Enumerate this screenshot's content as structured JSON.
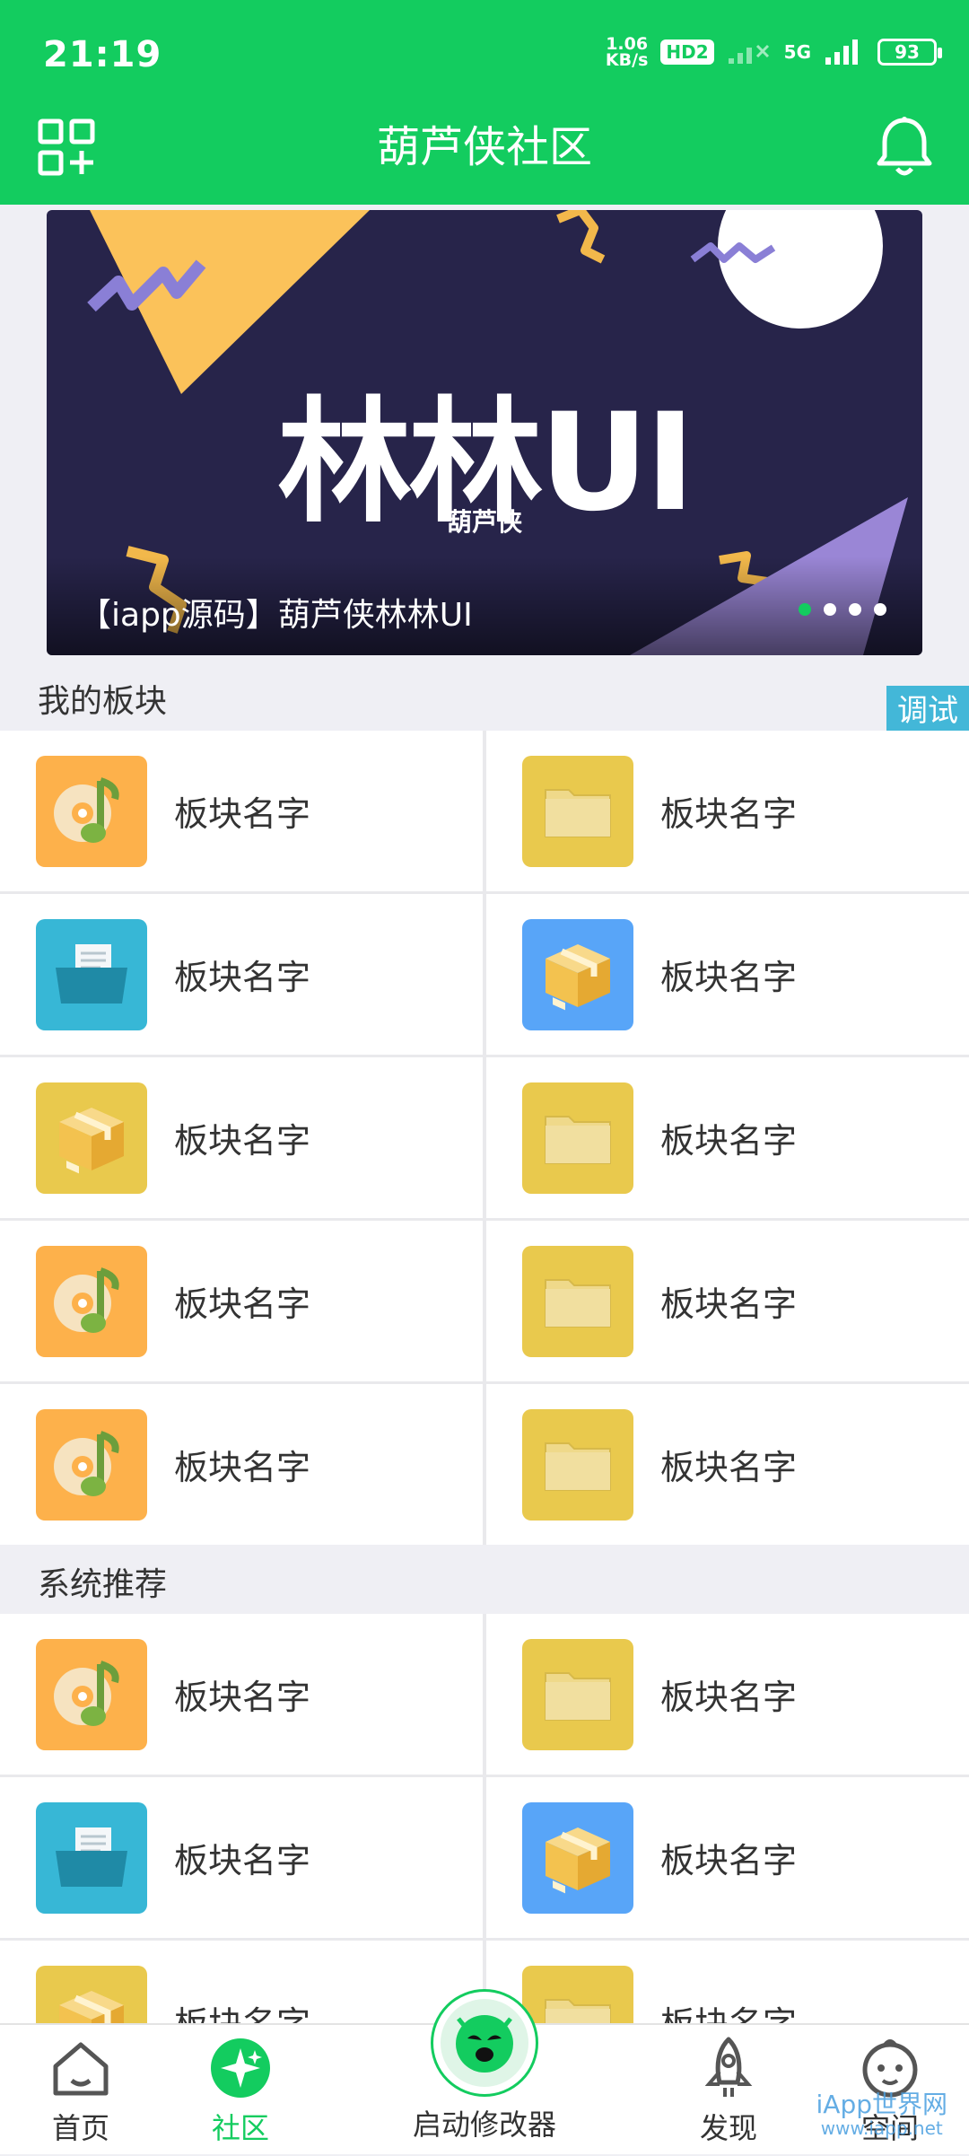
{
  "status_bar": {
    "time": "21:19",
    "net_speed_value": "1.06",
    "net_speed_unit": "KB/s",
    "hd_badge": "HD2",
    "network": "5G",
    "battery": "93"
  },
  "header": {
    "title": "葫芦侠社区"
  },
  "banner": {
    "headline": "林林UI",
    "subline": "葫芦侠",
    "caption": "【iapp源码】葫芦侠林林UI",
    "page_count": 4,
    "active_index": 0
  },
  "debug_label": "调试",
  "my_boards": {
    "title": "我的板块",
    "items": [
      {
        "label": "板块名字",
        "icon": "music-disc-icon",
        "color": "#fdb14b"
      },
      {
        "label": "板块名字",
        "icon": "folder-icon",
        "color": "#e9c94d"
      },
      {
        "label": "板块名字",
        "icon": "file-folder-icon",
        "color": "#37b7d6"
      },
      {
        "label": "板块名字",
        "icon": "package-box-icon",
        "color": "#58a5f8"
      },
      {
        "label": "板块名字",
        "icon": "package-box-icon",
        "color": "#e9c94d"
      },
      {
        "label": "板块名字",
        "icon": "folder-icon",
        "color": "#e9c94d"
      },
      {
        "label": "板块名字",
        "icon": "music-disc-icon",
        "color": "#fdb14b"
      },
      {
        "label": "板块名字",
        "icon": "folder-icon",
        "color": "#e9c94d"
      },
      {
        "label": "板块名字",
        "icon": "music-disc-icon",
        "color": "#fdb14b"
      },
      {
        "label": "板块名字",
        "icon": "folder-icon",
        "color": "#e9c94d"
      }
    ]
  },
  "recommended": {
    "title": "系统推荐",
    "items": [
      {
        "label": "板块名字",
        "icon": "music-disc-icon",
        "color": "#fdb14b"
      },
      {
        "label": "板块名字",
        "icon": "folder-icon",
        "color": "#e9c94d"
      },
      {
        "label": "板块名字",
        "icon": "file-folder-icon",
        "color": "#37b7d6"
      },
      {
        "label": "板块名字",
        "icon": "package-box-icon",
        "color": "#58a5f8"
      },
      {
        "label": "板块名字",
        "icon": "package-box-icon",
        "color": "#e9c94d"
      },
      {
        "label": "板块名字",
        "icon": "folder-icon",
        "color": "#e9c94d"
      }
    ]
  },
  "bottom_nav": {
    "home": "首页",
    "community": "社区",
    "center": "启动修改器",
    "discover": "发现",
    "space": "空间"
  },
  "watermark": {
    "line1": "iApp世界网",
    "line2": "www.iapp.net"
  },
  "colors": {
    "primary": "#13cc5f",
    "banner_bg": "#27244a"
  }
}
